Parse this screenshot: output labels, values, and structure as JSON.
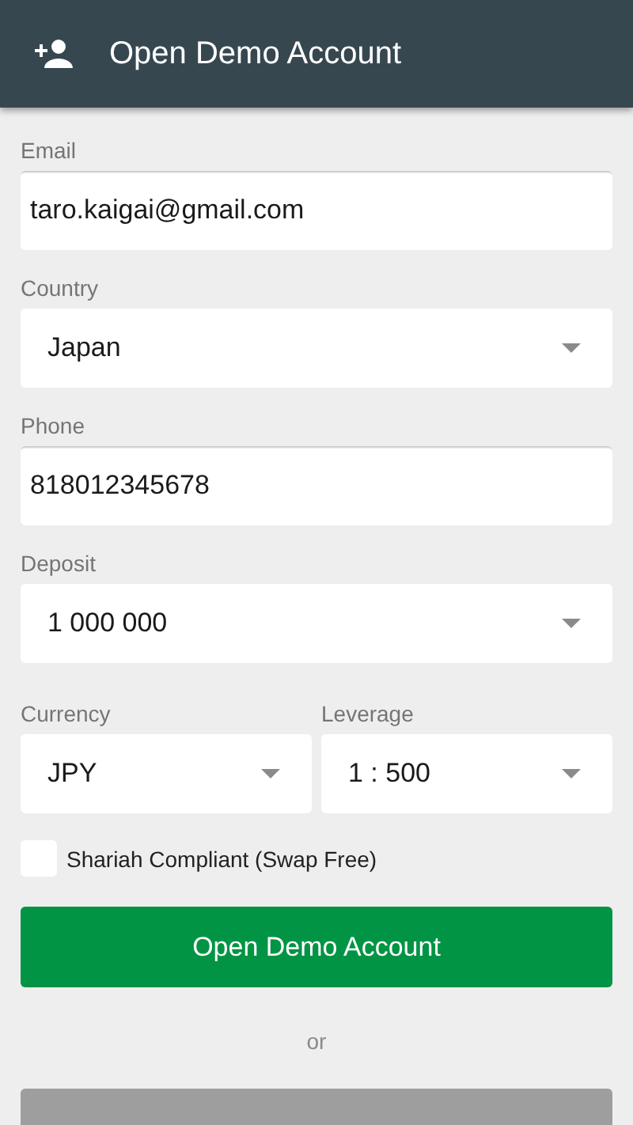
{
  "header": {
    "title": "Open Demo Account"
  },
  "fields": [
    {
      "kind": "input",
      "label": "Email",
      "value": "taro.kaigai@gmail.com"
    },
    {
      "kind": "select",
      "label": "Country",
      "value": "Japan"
    },
    {
      "kind": "input",
      "label": "Phone",
      "value": "818012345678"
    },
    {
      "kind": "select",
      "label": "Deposit",
      "value": "1 000 000"
    }
  ],
  "pair": [
    {
      "kind": "select",
      "label": "Currency",
      "value": "JPY"
    },
    {
      "kind": "select",
      "label": "Leverage",
      "value": "1 : 500"
    }
  ],
  "checkbox": {
    "label": "Shariah Compliant (Swap Free)",
    "checked": false
  },
  "submit": "Open Demo Account",
  "separator": "or"
}
